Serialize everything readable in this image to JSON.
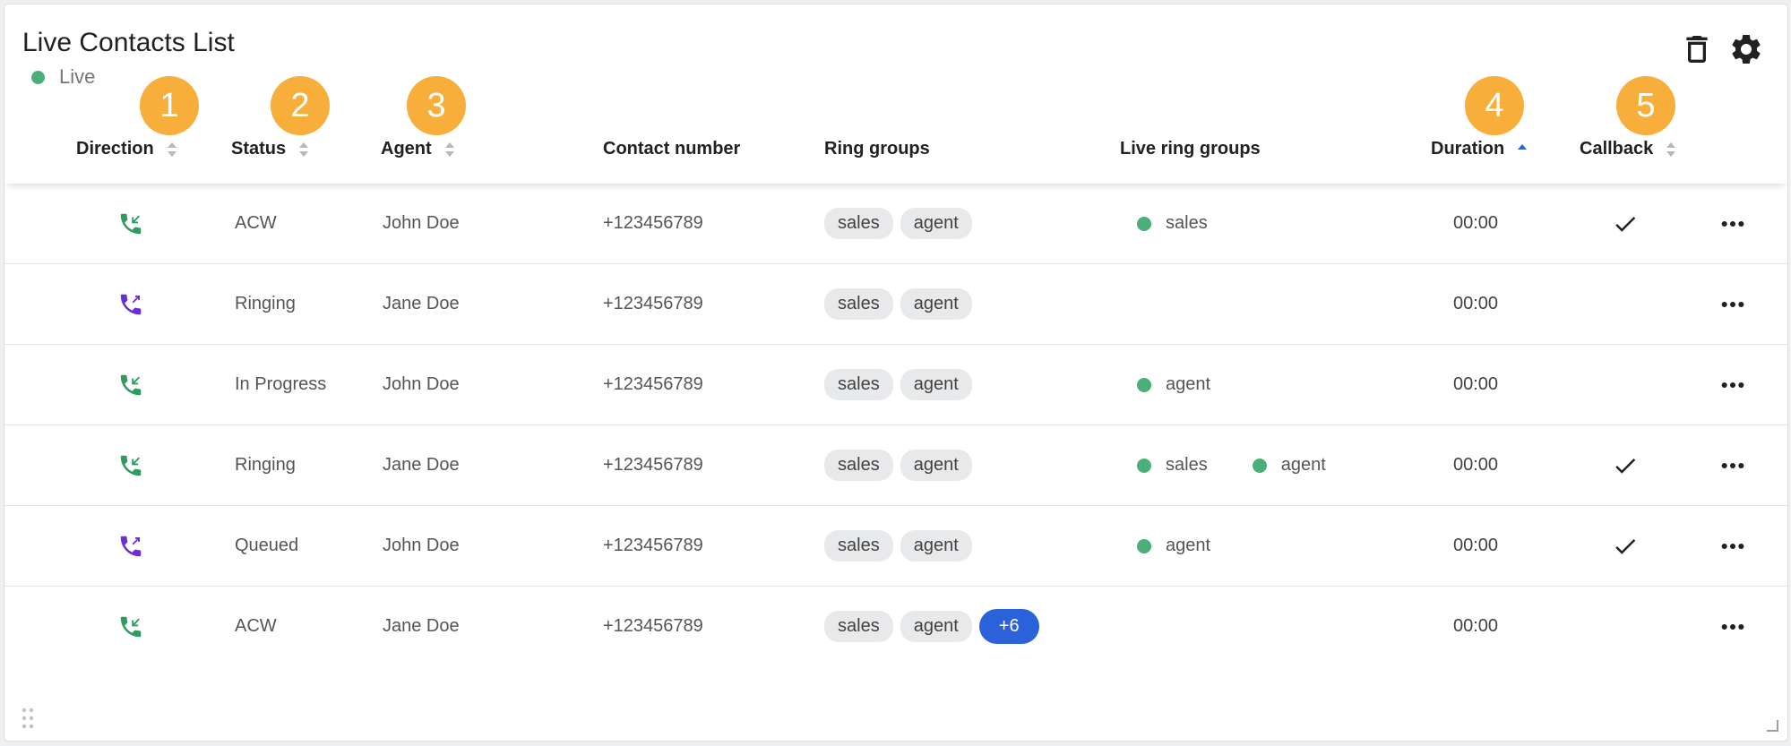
{
  "widget": {
    "title": "Live Contacts List",
    "live_label": "Live",
    "live_color": "#4caf7a",
    "header_icons": [
      "trash-icon",
      "gear-icon"
    ]
  },
  "badges": [
    "1",
    "2",
    "3",
    "4",
    "5"
  ],
  "badge_color": "#f7ae3b",
  "columns": {
    "direction": "Direction",
    "status": "Status",
    "agent": "Agent",
    "contact_number": "Contact number",
    "ring_groups": "Ring groups",
    "live_ring_groups": "Live ring groups",
    "duration": "Duration",
    "callback": "Callback"
  },
  "sort_state": {
    "duration": "ascending"
  },
  "direction_colors": {
    "inbound": "#2e9c5e",
    "outbound": "#6a2fd6"
  },
  "rows": [
    {
      "direction": "inbound",
      "status": "ACW",
      "agent": "John Doe",
      "contact": "+123456789",
      "ring_groups": [
        "sales",
        "agent"
      ],
      "more": "",
      "live_ring_groups": [
        "sales"
      ],
      "duration": "00:00",
      "callback": true
    },
    {
      "direction": "outbound",
      "status": "Ringing",
      "agent": "Jane Doe",
      "contact": "+123456789",
      "ring_groups": [
        "sales",
        "agent"
      ],
      "more": "",
      "live_ring_groups": [],
      "duration": "00:00",
      "callback": false
    },
    {
      "direction": "inbound",
      "status": "In Progress",
      "agent": "John Doe",
      "contact": "+123456789",
      "ring_groups": [
        "sales",
        "agent"
      ],
      "more": "",
      "live_ring_groups": [
        "agent"
      ],
      "duration": "00:00",
      "callback": false
    },
    {
      "direction": "inbound",
      "status": "Ringing",
      "agent": "Jane Doe",
      "contact": "+123456789",
      "ring_groups": [
        "sales",
        "agent"
      ],
      "more": "",
      "live_ring_groups": [
        "sales",
        "agent"
      ],
      "duration": "00:00",
      "callback": true
    },
    {
      "direction": "outbound",
      "status": "Queued",
      "agent": "John Doe",
      "contact": "+123456789",
      "ring_groups": [
        "sales",
        "agent"
      ],
      "more": "",
      "live_ring_groups": [
        "agent"
      ],
      "duration": "00:00",
      "callback": true
    },
    {
      "direction": "inbound",
      "status": "ACW",
      "agent": "Jane Doe",
      "contact": "+123456789",
      "ring_groups": [
        "sales",
        "agent"
      ],
      "more": "+6",
      "live_ring_groups": [],
      "duration": "00:00",
      "callback": false
    }
  ]
}
